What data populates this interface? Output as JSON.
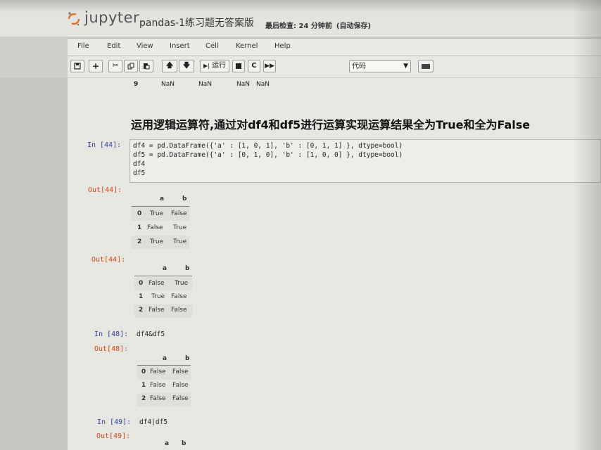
{
  "header": {
    "logo_text": "jupyter",
    "notebook_title": "pandas-1练习题无答案版",
    "checkpoint_label": "最后检查: 24 分钟前",
    "autosave_label": "(自动保存)"
  },
  "menu": {
    "items": [
      "File",
      "Edit",
      "View",
      "Insert",
      "Cell",
      "Kernel",
      "Help"
    ]
  },
  "toolbar": {
    "run_label": "运行",
    "cell_type": "代码",
    "icons": [
      "save-icon",
      "plus-icon",
      "cut-icon",
      "copy-icon",
      "paste-icon",
      "arrow-up-icon",
      "arrow-down-icon",
      "run-icon",
      "stop-icon",
      "restart-icon",
      "fast-forward-icon",
      "keyboard-icon"
    ]
  },
  "prev_output": {
    "row": [
      "9",
      "NaN",
      "NaN",
      "NaN",
      "NaN"
    ]
  },
  "markdown_heading": "运用逻辑运算符,通过对df4和df5进行运算实现运算结果全为True和全为False",
  "cells": {
    "cell44": {
      "in_prompt": "In [44]:",
      "code": [
        "df4 = pd.DataFrame({'a' : [1, 0, 1], 'b' : [0, 1, 1] }, dtype=bool)",
        "df5 = pd.DataFrame({'a' : [0, 1, 0], 'b' : [1, 0, 0] }, dtype=bool)",
        "df4",
        "df5"
      ],
      "out_prompt_1": "Out[44]:",
      "out_prompt_2": "Out[44]:"
    },
    "cell48": {
      "in_prompt": "In [48]:",
      "code": "df4&df5",
      "out_prompt": "Out[48]:"
    },
    "cell49": {
      "in_prompt": "In [49]:",
      "code": "df4|df5",
      "out_prompt": "Out[49]:"
    }
  },
  "tables": {
    "df4": {
      "columns": [
        "a",
        "b"
      ],
      "rows": [
        [
          "0",
          "True",
          "False"
        ],
        [
          "1",
          "False",
          "True"
        ],
        [
          "2",
          "True",
          "True"
        ]
      ]
    },
    "df5": {
      "columns": [
        "a",
        "b"
      ],
      "rows": [
        [
          "0",
          "False",
          "True"
        ],
        [
          "1",
          "True",
          "False"
        ],
        [
          "2",
          "False",
          "False"
        ]
      ]
    },
    "and_result": {
      "columns": [
        "a",
        "b"
      ],
      "rows": [
        [
          "0",
          "False",
          "False"
        ],
        [
          "1",
          "False",
          "False"
        ],
        [
          "2",
          "False",
          "False"
        ]
      ]
    },
    "or_partial": {
      "columns": [
        "a",
        "b"
      ]
    }
  },
  "colors": {
    "in_prompt": "#303f9f",
    "out_prompt": "#d84315",
    "background": "#e7e7e2"
  }
}
